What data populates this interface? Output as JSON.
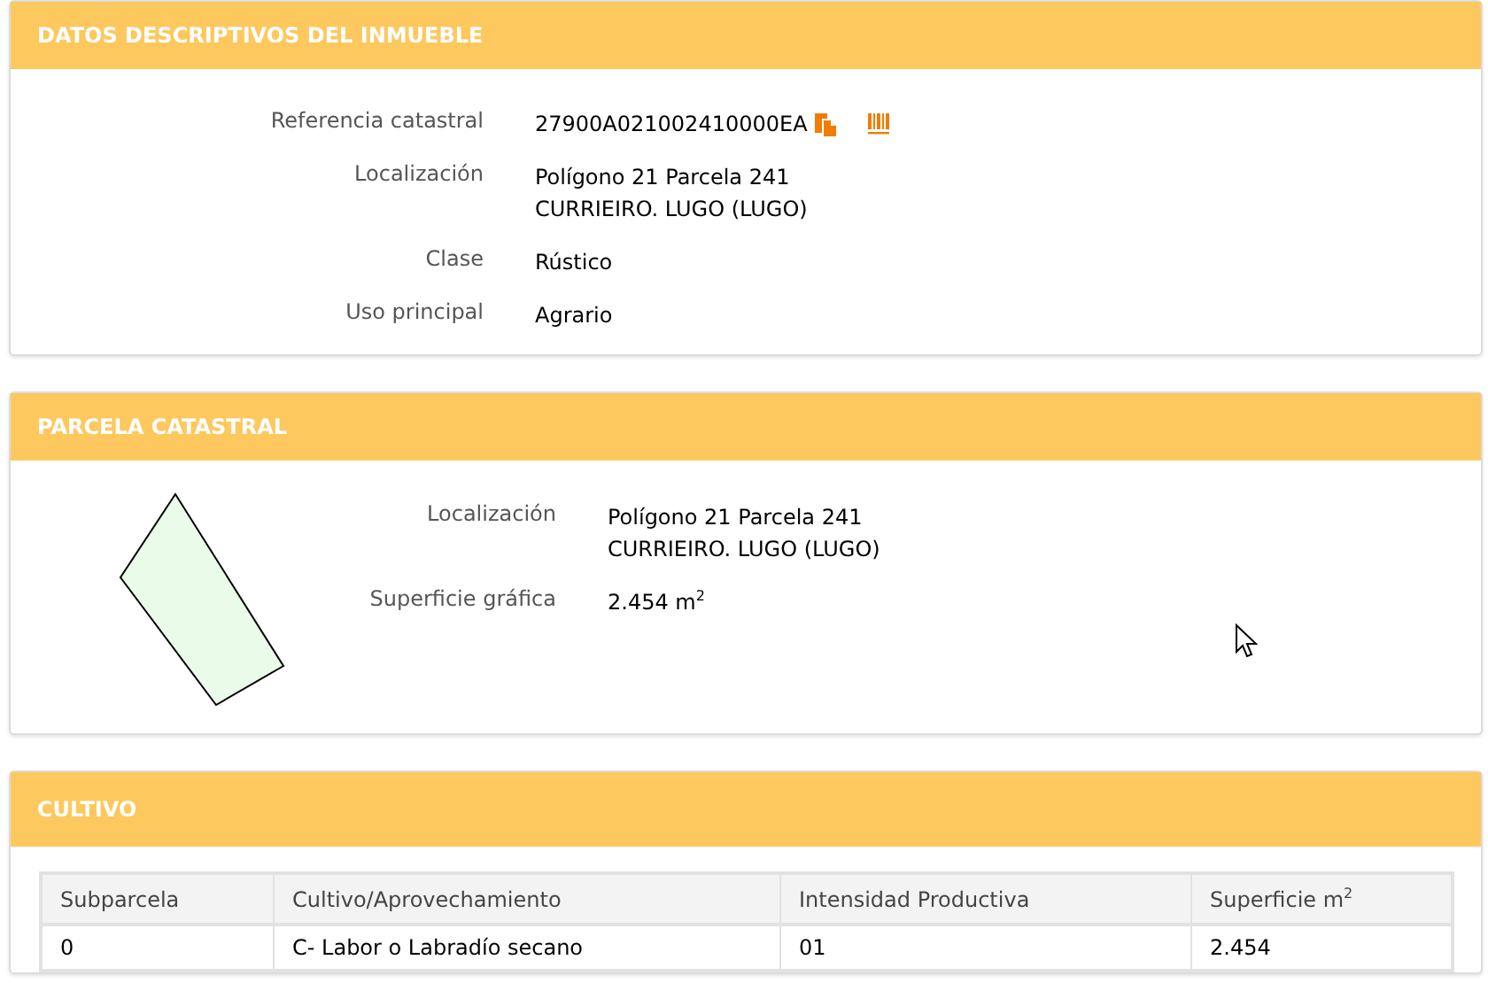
{
  "sections": [
    {
      "kind": "fields",
      "title": "DATOS DESCRIPTIVOS DEL INMUEBLE",
      "fields": [
        {
          "label": "Referencia catastral",
          "lines": [
            "27900A021002410000EA"
          ],
          "icons": true
        },
        {
          "label": "Localización",
          "lines": [
            "Polígono 21 Parcela 241",
            "CURRIEIRO. LUGO (LUGO)"
          ]
        },
        {
          "label": "Clase",
          "lines": [
            "Rústico"
          ]
        },
        {
          "label": "Uso principal",
          "lines": [
            "Agrario"
          ]
        }
      ]
    },
    {
      "kind": "parcel",
      "title": "PARCELA CATASTRAL",
      "fields": [
        {
          "label": "Localización",
          "lines": [
            "Polígono 21 Parcela 241",
            "CURRIEIRO. LUGO (LUGO)"
          ]
        },
        {
          "label": "Superficie gráfica",
          "lines": [
            "2.454 m$^{2}$"
          ]
        }
      ]
    },
    {
      "kind": "table",
      "title": "CULTIVO",
      "columns": [
        "Subparcela",
        "Cultivo/Aprovechamiento",
        "Intensidad Productiva",
        "Superficie m$^{2}$"
      ],
      "rows": [
        [
          "0",
          "C- Labor o Labradío secano",
          "01",
          "2.454"
        ]
      ]
    }
  ]
}
